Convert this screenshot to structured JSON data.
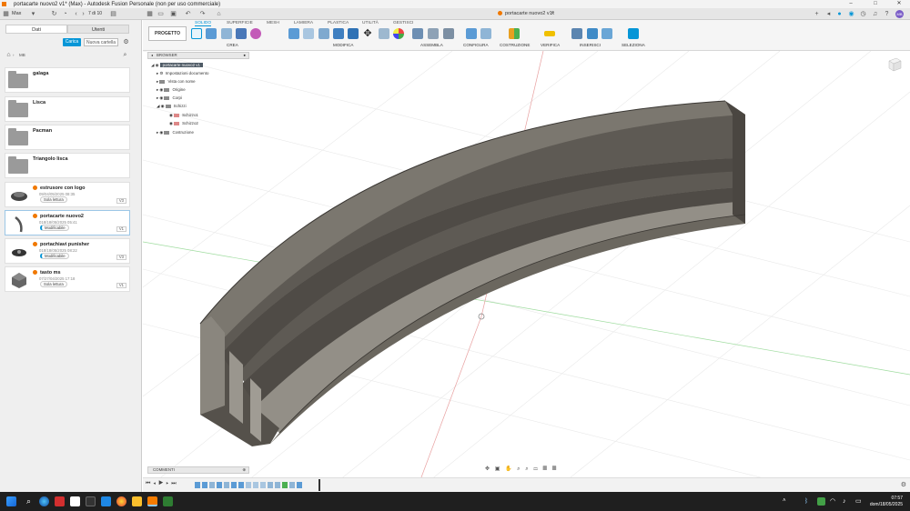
{
  "window": {
    "title": "portacarte nuovo2 v1* (Max) - Autodesk Fusion Personale (non per uso commerciale)",
    "minimize": "–",
    "maximize": "□",
    "close": "✕"
  },
  "appbar": {
    "user": "Max",
    "count": "7 di 10",
    "doc_tab": "portacarte nuovo2 v1*"
  },
  "left_panel": {
    "tabs": [
      "Dati",
      "Utenti"
    ],
    "upload_label": "Carica",
    "new_folder_label": "Nuova cartella",
    "breadcrumb": "MB",
    "folders": [
      {
        "name": "galaga"
      },
      {
        "name": "Lisca"
      },
      {
        "name": "Pacman"
      },
      {
        "name": "Triangolo lisca"
      }
    ],
    "files": [
      {
        "name": "estrusore con logo",
        "date": "09/04/05/2025 08:35",
        "tag": "Sola lettura",
        "version": "V3"
      },
      {
        "name": "portacarte nuovo2",
        "date": "018/18/05/2025 05:41",
        "tag": "Modificabile",
        "version": "V1"
      },
      {
        "name": "portachiavi punisher",
        "date": "018/18/05/2025 08:22",
        "tag": "Modificabile",
        "version": "V3"
      },
      {
        "name": "tasto ms",
        "date": "07/27/04/2025 17:18",
        "tag": "Sola lettura",
        "version": "V1"
      }
    ]
  },
  "ribbon": {
    "project_label": "PROGETTO",
    "tabs": [
      "SOLIDO",
      "SUPERFICIE",
      "MESH",
      "LAMIERA",
      "PLASTICA",
      "UTILITÀ",
      "GESTISCI"
    ],
    "active_tab": "SOLIDO",
    "groups": [
      "CREA",
      "MODIFICA",
      "ASSEMBLA",
      "CONFIGURA",
      "COSTRUZIONE",
      "VERIFICA",
      "INSERISCI",
      "SELEZIONA"
    ]
  },
  "browser": {
    "header": "BROWSER",
    "root": "portacarte nuovo2 v1",
    "items": [
      "Impostazioni documento",
      "Vista con nome",
      "Origine",
      "Corpi",
      "Schizzi",
      "Schizzo1",
      "Schizzo2",
      "Costruzione"
    ]
  },
  "comments": {
    "label": "COMMENTI"
  },
  "taskbar": {
    "time": "07:57",
    "date": "dom/18/05/2025"
  },
  "colors": {
    "accent": "#0696d7",
    "model": "#6e6a63",
    "taskbar": "#1f1f1f"
  }
}
